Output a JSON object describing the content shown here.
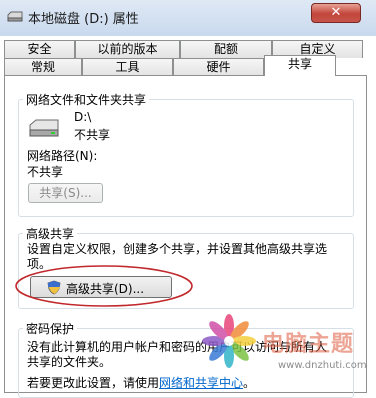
{
  "window": {
    "title": "本地磁盘 (D:) 属性",
    "close_symbol": "✕"
  },
  "tabs": {
    "row1": [
      "安全",
      "以前的版本",
      "配额",
      "自定义"
    ],
    "row2": [
      "常规",
      "工具",
      "硬件",
      "共享"
    ],
    "active": "共享"
  },
  "network_sharing": {
    "group_label": "网络文件和文件夹共享",
    "drive_name": "D:\\",
    "status": "不共享",
    "path_label": "网络路径(N):",
    "path_value": "不共享",
    "share_button": "共享(S)..."
  },
  "advanced_sharing": {
    "group_label": "高级共享",
    "description_line1": "设置自定义权限，创建多个共享，并设置其他高级共享选",
    "description_line2": "项。",
    "button_label": "高级共享(D)..."
  },
  "password_protection": {
    "group_label": "密码保护",
    "line1": "没有此计算机的用户帐户和密码的用户可以访问与所有人",
    "line2": "共享的文件夹。",
    "line3_prefix": "若要更改此设置，请使用",
    "line3_link": "网络和共享中心",
    "line3_suffix": "。"
  },
  "watermark": {
    "text": "电脑主题",
    "url": "www.dnzhuti.com"
  },
  "colors": {
    "accent_link": "#0066cc",
    "close_red": "#c2453a",
    "annotation_ellipse": "#c0282c"
  }
}
